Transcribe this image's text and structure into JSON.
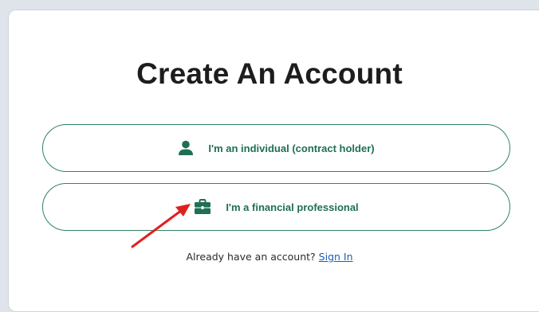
{
  "page": {
    "title": "Create An Account"
  },
  "options": {
    "individual_label": "I'm an individual (contract holder)",
    "individual_icon": "person-icon",
    "professional_label": "I'm a financial professional",
    "professional_icon": "briefcase-icon"
  },
  "signin": {
    "prompt": "Already have an account?",
    "link": "Sign In"
  },
  "colors": {
    "accent": "#1f6f52",
    "border": "#2e8468",
    "link": "#1a5fb4",
    "annotation_arrow": "#e02020"
  }
}
